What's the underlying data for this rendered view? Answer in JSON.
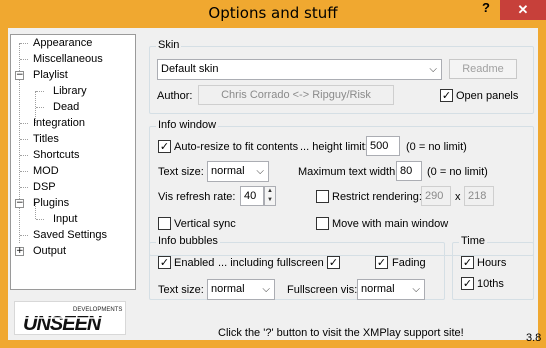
{
  "window": {
    "title": "Options and stuff",
    "help_label": "?",
    "close_label": "✕"
  },
  "tree": [
    {
      "label": "Appearance",
      "expander": ""
    },
    {
      "label": "Miscellaneous",
      "expander": ""
    },
    {
      "label": "Playlist",
      "expander": "−"
    },
    {
      "label": "Library",
      "expander": ""
    },
    {
      "label": "Dead",
      "expander": ""
    },
    {
      "label": "Integration",
      "expander": ""
    },
    {
      "label": "Titles",
      "expander": ""
    },
    {
      "label": "Shortcuts",
      "expander": ""
    },
    {
      "label": "MOD",
      "expander": ""
    },
    {
      "label": "DSP",
      "expander": ""
    },
    {
      "label": "Plugins",
      "expander": "−"
    },
    {
      "label": "Input",
      "expander": ""
    },
    {
      "label": "Saved Settings",
      "expander": ""
    },
    {
      "label": "Output",
      "expander": "+"
    }
  ],
  "logo": {
    "main": "UNSEEN",
    "sub": "DEVELOPMENTS"
  },
  "skin": {
    "group_label": "Skin",
    "selected": "Default skin",
    "readme_label": "Readme",
    "author_label": "Author:",
    "author_value": "Chris Corrado <-> Ripguy/Risk",
    "open_panels_label": "Open panels",
    "open_panels_checked": "✓"
  },
  "info_window": {
    "group_label": "Info window",
    "auto_resize_label": "Auto-resize to fit contents",
    "auto_resize_checked": "✓",
    "height_limit_label": "... height limit:",
    "height_limit_value": "500",
    "height_limit_note": "(0 = no limit)",
    "text_size_label": "Text size:",
    "text_size_value": "normal",
    "max_width_label": "Maximum text width:",
    "max_width_value": "80",
    "max_width_note": "(0 = no limit)",
    "vis_refresh_label": "Vis refresh rate:",
    "vis_refresh_value": "40",
    "restrict_label": "Restrict rendering:",
    "restrict_checked": "",
    "restrict_w": "290",
    "restrict_x": "x",
    "restrict_h": "218",
    "vsync_label": "Vertical sync",
    "vsync_checked": "",
    "move_with_main_label": "Move with main window",
    "move_with_main_checked": ""
  },
  "info_bubbles": {
    "group_label": "Info bubbles",
    "enabled_label": "Enabled",
    "enabled_checked": "✓",
    "fullscreen_label": "... including fullscreen",
    "fullscreen_checked": "✓",
    "fading_label": "Fading",
    "fading_checked": "✓",
    "text_size_label": "Text size:",
    "text_size_value": "normal",
    "fullscreen_vis_label": "Fullscreen vis:",
    "fullscreen_vis_value": "normal"
  },
  "time": {
    "group_label": "Time",
    "hours_label": "Hours",
    "hours_checked": "✓",
    "tenths_label": "10ths",
    "tenths_checked": "✓"
  },
  "footer": {
    "hint": "Click the '?' button to visit the XMPlay support site!",
    "version": "3.8"
  },
  "colors": {
    "titlebar": "#f0a830",
    "close_button": "#c7403a",
    "client_bg": "#f0f0f0"
  }
}
